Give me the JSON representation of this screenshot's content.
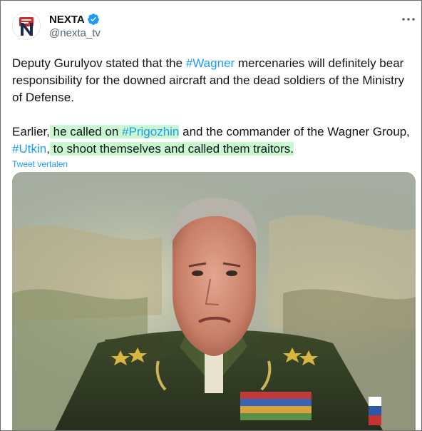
{
  "tweet": {
    "author_name": "NEXTA",
    "author_handle": "@nexta_tv",
    "avatar_icon": "nexta-logo-icon",
    "verified_icon": "verified-badge-icon",
    "more_icon": "more-options-icon",
    "text": {
      "p1_before": "Deputy Gurulyov stated that the ",
      "p1_hashtag": "#Wagner",
      "p1_after": " mercenaries will definitely bear responsibility for the downed aircraft and the dead soldiers of the Ministry of Defense.",
      "p2_before": "Earlier,",
      "p2_hl1_before": " he called on ",
      "p2_hl1_hashtag": "#Prigozhin",
      "p2_mid": " and the commander of the Wagner Group, ",
      "p2_hashtag2": "#Utkin",
      "p2_comma": ",",
      "p2_hl2": " to shoot themselves and called them traitors."
    },
    "translate_label": "Tweet vertalen",
    "media_alt": "photo of a man in military uniform"
  },
  "colors": {
    "link": "#1d9bf0",
    "highlight": "#c9f7cf",
    "text": "#0f1419",
    "secondary": "#536471"
  }
}
